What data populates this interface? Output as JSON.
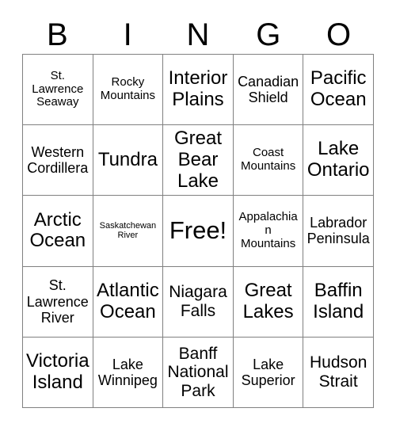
{
  "header": {
    "letters": [
      "B",
      "I",
      "N",
      "G",
      "O"
    ]
  },
  "grid": {
    "rows": 5,
    "columns": 5,
    "cells": [
      {
        "text": "St. Lawrence Seaway",
        "size": "sm",
        "free": false
      },
      {
        "text": "Rocky Mountains",
        "size": "sm",
        "free": false
      },
      {
        "text": "Interior Plains",
        "size": "xl",
        "free": false
      },
      {
        "text": "Canadian Shield",
        "size": "md",
        "free": false
      },
      {
        "text": "Pacific Ocean",
        "size": "xl",
        "free": false
      },
      {
        "text": "Western Cordillera",
        "size": "md",
        "free": false
      },
      {
        "text": "Tundra",
        "size": "xl",
        "free": false
      },
      {
        "text": "Great Bear Lake",
        "size": "xl",
        "free": false
      },
      {
        "text": "Coast Mountains",
        "size": "sm",
        "free": false
      },
      {
        "text": "Lake Ontario",
        "size": "xl",
        "free": false
      },
      {
        "text": "Arctic Ocean",
        "size": "xl",
        "free": false
      },
      {
        "text": "Saskatchewan River",
        "size": "xs",
        "free": false
      },
      {
        "text": "Free!",
        "size": "free",
        "free": true
      },
      {
        "text": "Appalachian Mountains",
        "size": "sm",
        "free": false
      },
      {
        "text": "Labrador Peninsula",
        "size": "md",
        "free": false
      },
      {
        "text": "St. Lawrence River",
        "size": "md",
        "free": false
      },
      {
        "text": "Atlantic Ocean",
        "size": "xl",
        "free": false
      },
      {
        "text": "Niagara Falls",
        "size": "lg",
        "free": false
      },
      {
        "text": "Great Lakes",
        "size": "xl",
        "free": false
      },
      {
        "text": "Baffin Island",
        "size": "xl",
        "free": false
      },
      {
        "text": "Victoria Island",
        "size": "xl",
        "free": false
      },
      {
        "text": "Lake Winnipeg",
        "size": "md",
        "free": false
      },
      {
        "text": "Banff National Park",
        "size": "lg",
        "free": false
      },
      {
        "text": "Lake Superior",
        "size": "md",
        "free": false
      },
      {
        "text": "Hudson Strait",
        "size": "lg",
        "free": false
      }
    ]
  },
  "colors": {
    "text": "#000000",
    "grid_line": "#808080",
    "background": "#ffffff"
  }
}
